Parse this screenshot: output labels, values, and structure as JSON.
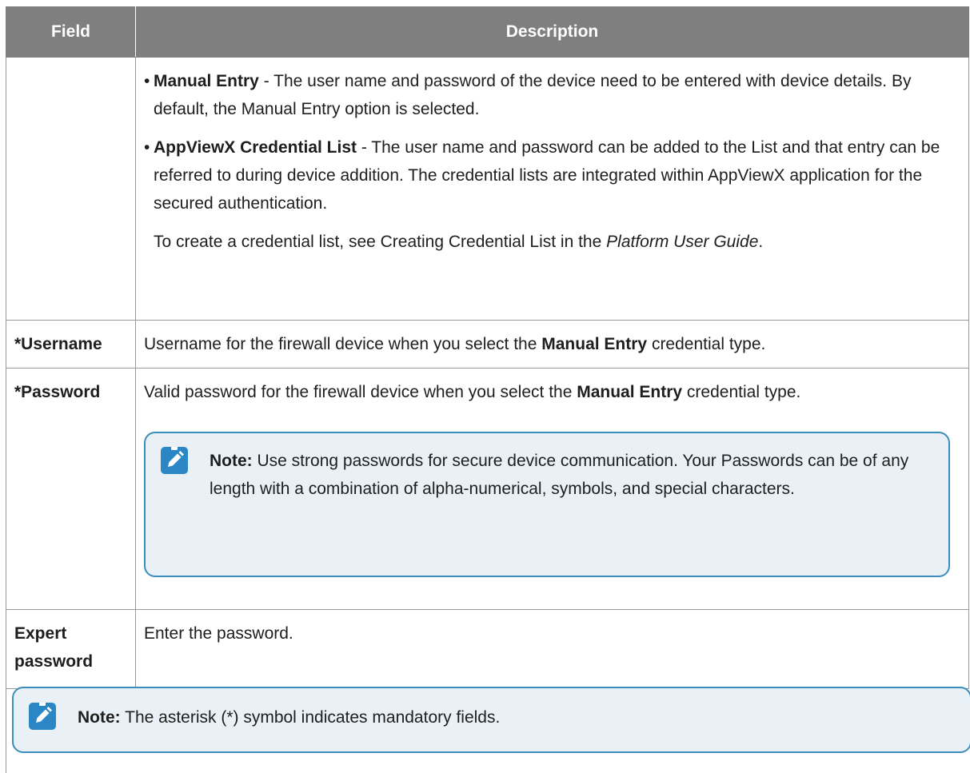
{
  "table": {
    "headers": {
      "field": "Field",
      "description": "Description"
    },
    "credential_row": {
      "manual_entry": {
        "bullet": "•",
        "label": "Manual Entry",
        "text": " - The user name and password of the device need to be entered with device details. By default, the Manual Entry option is selected."
      },
      "credential_list": {
        "bullet": "•",
        "label": "AppViewX Credential List",
        "text": " - The user name and password can be added to the List and that entry can be referred to during device addition. The credential lists are integrated within AppViewX application for the secured authentication."
      },
      "reference": {
        "prefix": "To create a credential list, see Creating Credential List in the ",
        "guide": "Platform User Guide",
        "suffix": "."
      }
    },
    "username_row": {
      "field": "*Username",
      "prefix": "Username for the firewall device when you select the ",
      "bold": "Manual Entry",
      "suffix": " credential type."
    },
    "password_row": {
      "field": "*Password",
      "prefix": "Valid password for the firewall device when you select the ",
      "bold": "Manual Entry",
      "suffix": " credential type.",
      "note": {
        "label": "Note:",
        "text": " Use strong passwords for secure device communication. Your Passwords can be of any length with a combination of alpha-numerical, symbols, and special characters."
      }
    },
    "expert_row": {
      "field": "Expert password",
      "description": "Enter the password."
    }
  },
  "footer_note": {
    "label": "Note:",
    "text": " The asterisk (*) symbol indicates mandatory fields."
  },
  "colors": {
    "header_bg": "#7f7f7f",
    "note_border": "#3b8ebc",
    "note_bg": "#e9f1f6",
    "icon_bg": "#2a86c5"
  },
  "icons": {
    "note": "pencil-note-icon"
  }
}
